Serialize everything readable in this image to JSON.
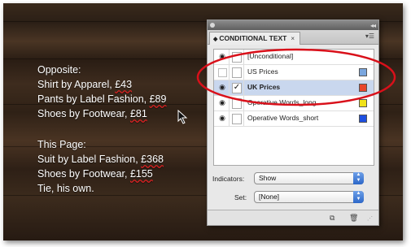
{
  "copy": {
    "opposite_heading": "Opposite:",
    "opposite_lines": [
      {
        "prefix": "Shirt by Apparel, ",
        "price": "£43"
      },
      {
        "prefix": "Pants by Label Fashion, ",
        "price": "£89"
      },
      {
        "prefix": "Shoes by Footwear, ",
        "price": "£81"
      }
    ],
    "this_page_heading": "This Page:",
    "this_page_lines": [
      {
        "prefix": "Suit by Label Fashion, ",
        "price": "£368"
      },
      {
        "prefix": "Shoes by Footwear, ",
        "price": "£155"
      }
    ],
    "tie_line": "Tie, his own."
  },
  "panel": {
    "tab_label": "CONDITIONAL TEXT",
    "conditions": [
      {
        "label": "[Unconditional]",
        "visible": true,
        "checked": false,
        "color": ""
      },
      {
        "label": "US Prices",
        "visible": false,
        "checked": false,
        "color": "#7aa6de"
      },
      {
        "label": "UK Prices",
        "visible": true,
        "checked": true,
        "color": "#e8462b",
        "selected": true
      },
      {
        "label": "Operative Words_long",
        "visible": true,
        "checked": false,
        "color": "#f0e21a"
      },
      {
        "label": "Operative Words_short",
        "visible": true,
        "checked": false,
        "color": "#1d4fe0"
      }
    ],
    "indicators_label": "Indicators:",
    "indicators_value": "Show",
    "set_label": "Set:",
    "set_value": "[None]"
  },
  "colors": {
    "annotation": "#d9101a",
    "selection": "#c9d7ee"
  }
}
